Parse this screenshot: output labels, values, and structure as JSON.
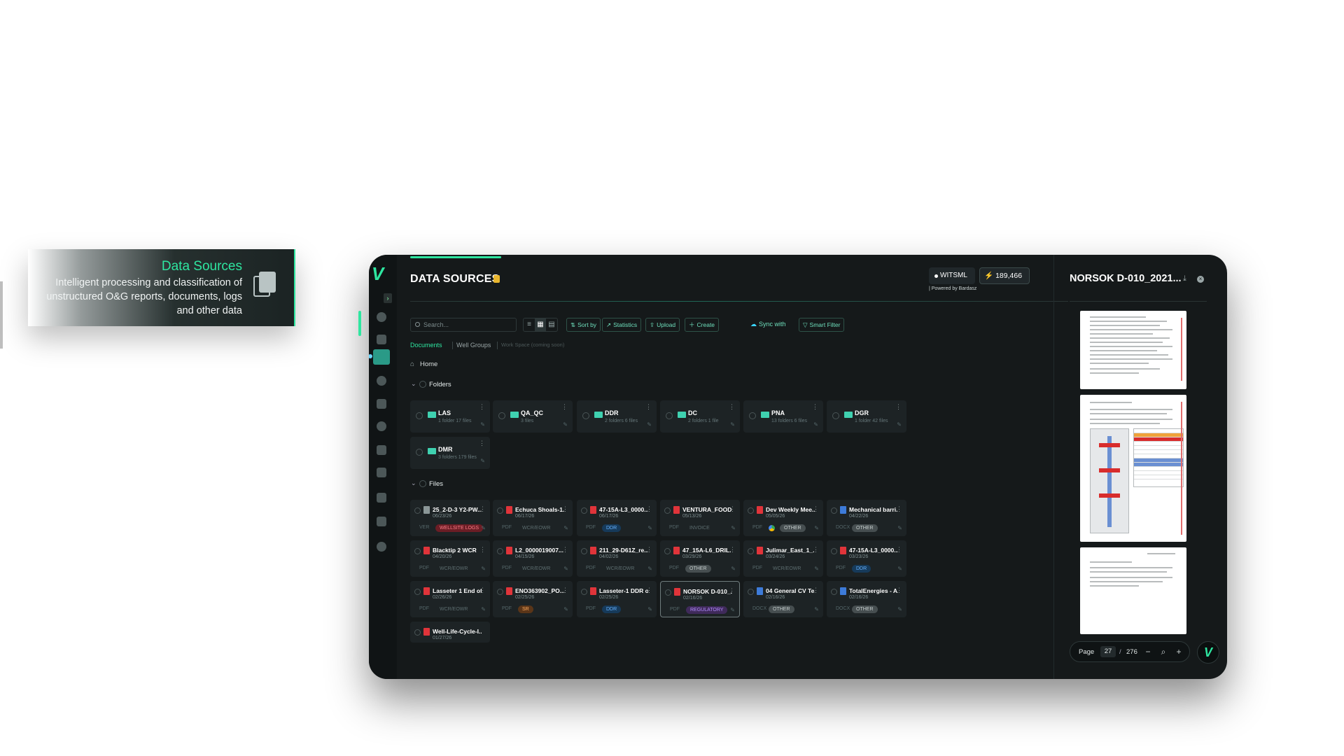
{
  "callout": {
    "title": "Data Sources",
    "description": "Intelligent processing and classification of unstructured O&G reports, documents, logs and other data"
  },
  "header": {
    "title": "DATA SOURCES",
    "witsml_label": "WITSML",
    "credits": "189,466",
    "powered_by": "| Powered by Bardasz"
  },
  "toolbar": {
    "search_placeholder": "Search...",
    "view_modes": [
      "list",
      "grid",
      "table"
    ],
    "sort": "Sort by",
    "statistics": "Statistics",
    "upload": "Upload",
    "create": "Create",
    "sync": "Sync with",
    "smart_filter": "Smart Filter"
  },
  "tabs": [
    {
      "label": "Documents",
      "state": "active"
    },
    {
      "label": "Well Groups",
      "state": "normal"
    },
    {
      "label": "Work Space (coming soon)",
      "state": "disabled"
    }
  ],
  "breadcrumb": {
    "home": "Home"
  },
  "sections": {
    "folders": "Folders",
    "files": "Files"
  },
  "folders": [
    {
      "name": "LAS",
      "info": "1 folder 17 files"
    },
    {
      "name": "QA_QC",
      "info": "3 files"
    },
    {
      "name": "DDR",
      "info": "2 folders 6 files"
    },
    {
      "name": "DC",
      "info": "2 folders 1 file"
    },
    {
      "name": "PNA",
      "info": "13 folders 6 files"
    },
    {
      "name": "DGR",
      "info": "1 folder 42 files"
    },
    {
      "name": "DMR",
      "info": "3 folders 179 files"
    }
  ],
  "files": [
    {
      "name": "25_2-D-3 Y2-PW...",
      "date": "06/23/26",
      "type": "VER",
      "tag": "WELLSITE LOGS",
      "tag_style": "red",
      "icon": "generic"
    },
    {
      "name": "Echuca Shoals-1...",
      "date": "06/17/26",
      "type": "PDF",
      "tag": "WCR/EOWR",
      "tag_style": "plain",
      "icon": "pdf"
    },
    {
      "name": "47-15A-L3_0000...",
      "date": "06/17/26",
      "type": "PDF",
      "tag": "DDR",
      "tag_style": "blue",
      "icon": "pdf"
    },
    {
      "name": "VENTURA_FOOD...",
      "date": "05/13/26",
      "type": "PDF",
      "tag": "INVOICE",
      "tag_style": "plain",
      "icon": "pdf"
    },
    {
      "name": "Dev Weekly Mee...",
      "date": "05/05/26",
      "type": "PDF",
      "tag": "OTHER",
      "tag_style": "gray",
      "icon": "pdf",
      "drive": true
    },
    {
      "name": "Mechanical barri...",
      "date": "04/22/26",
      "type": "DOCX",
      "tag": "OTHER",
      "tag_style": "gray",
      "icon": "doc"
    },
    {
      "name": "Blacktip 2 WCR",
      "date": "04/20/26",
      "type": "PDF",
      "tag": "WCR/EOWR",
      "tag_style": "plain",
      "icon": "pdf"
    },
    {
      "name": "L2_0000019007...",
      "date": "04/15/26",
      "type": "PDF",
      "tag": "WCR/EOWR",
      "tag_style": "plain",
      "icon": "pdf"
    },
    {
      "name": "211_29-D61Z_re...",
      "date": "04/02/26",
      "type": "PDF",
      "tag": "WCR/EOWR",
      "tag_style": "plain",
      "icon": "pdf"
    },
    {
      "name": "47_15A-L6_DRIL...",
      "date": "03/29/26",
      "type": "PDF",
      "tag": "OTHER",
      "tag_style": "gray",
      "icon": "pdf"
    },
    {
      "name": "Julimar_East_1_...",
      "date": "03/24/26",
      "type": "PDF",
      "tag": "WCR/EOWR",
      "tag_style": "plain",
      "icon": "pdf"
    },
    {
      "name": "47-15A-L3_0000...",
      "date": "03/23/26",
      "type": "PDF",
      "tag": "DDR",
      "tag_style": "blue",
      "icon": "pdf"
    },
    {
      "name": "Lasseter 1 End of...",
      "date": "02/26/26",
      "type": "PDF",
      "tag": "WCR/EOWR",
      "tag_style": "plain",
      "icon": "pdf"
    },
    {
      "name": "ENO363902_PO...",
      "date": "02/25/26",
      "type": "PDF",
      "tag": "SR",
      "tag_style": "orange",
      "icon": "pdf"
    },
    {
      "name": "Lasseter-1 DDR o...",
      "date": "02/25/26",
      "type": "PDF",
      "tag": "DDR",
      "tag_style": "blue",
      "icon": "pdf"
    },
    {
      "name": "NORSOK D-010_...",
      "date": "02/16/26",
      "type": "PDF",
      "tag": "REGULATORY",
      "tag_style": "purple",
      "icon": "pdf",
      "selected": true
    },
    {
      "name": "04 General CV Te...",
      "date": "02/16/26",
      "type": "DOCX",
      "tag": "OTHER",
      "tag_style": "gray",
      "icon": "doc"
    },
    {
      "name": "TotalEnergies - A...",
      "date": "02/16/26",
      "type": "DOCX",
      "tag": "OTHER",
      "tag_style": "gray",
      "icon": "doc"
    },
    {
      "name": "Well-Life-Cycle-I...",
      "date": "01/27/26",
      "type": "",
      "tag": "",
      "tag_style": "plain",
      "icon": "pdf"
    }
  ],
  "preview": {
    "title": "NORSOK D-010_2021...",
    "page_label": "Page",
    "current_page": "27",
    "separator": "/",
    "total_pages": "276"
  },
  "colors": {
    "accent": "#2ee6a0",
    "background": "#15191a",
    "card": "#1d2325"
  }
}
